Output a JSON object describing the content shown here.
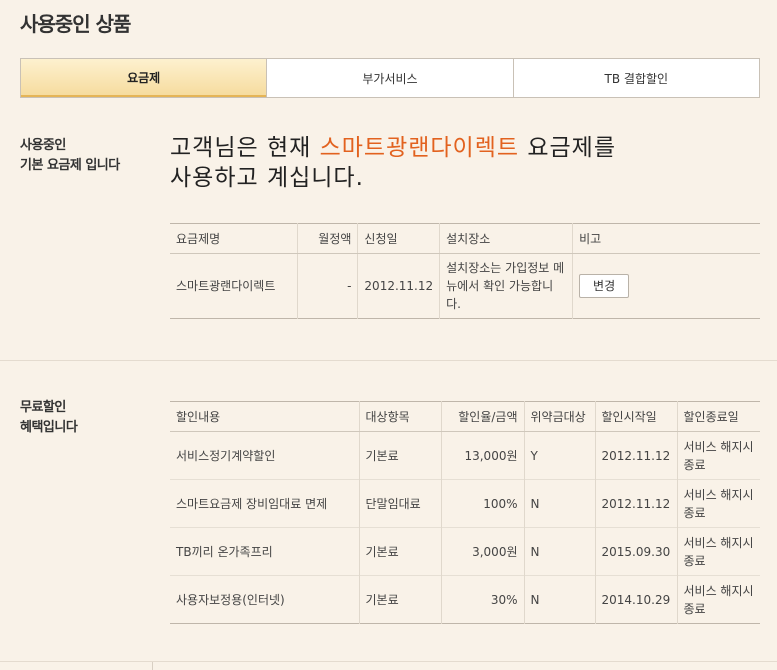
{
  "page": {
    "title": "사용중인 상품"
  },
  "tabs": [
    {
      "label": "요금제",
      "active": true
    },
    {
      "label": "부가서비스",
      "active": false
    },
    {
      "label": "TB 결합할인",
      "active": false
    }
  ],
  "basic_plan": {
    "section_label": "사용중인\n기본 요금제 입니다",
    "headline_prefix": "고객님은 현재 ",
    "headline_plan": "스마트광랜다이렉트",
    "headline_suffix_1": " 요금제를",
    "headline_line2": "사용하고 계십니다.",
    "highlight_color": "#e2621f",
    "columns": [
      "요금제명",
      "월정액",
      "신청일",
      "설치장소",
      "비고"
    ],
    "rows": [
      {
        "name": "스마트광랜다이렉트",
        "monthly_fee": "-",
        "apply_date": "2012.11.12",
        "location": "설치장소는 가입정보 메뉴에서 확인 가능합니다.",
        "action_label": "변경"
      }
    ]
  },
  "discounts": {
    "section_label": "무료할인\n혜택입니다",
    "columns": [
      "할인내용",
      "대상항목",
      "할인율/금액",
      "위약금대상",
      "할인시작일",
      "할인종료일"
    ],
    "rows": [
      {
        "content": "서비스정기계약할인",
        "target": "기본료",
        "amount": "13,000원",
        "penalty": "Y",
        "start": "2012.11.12",
        "end": "서비스 해지시 종료"
      },
      {
        "content": "스마트요금제 장비임대료 면제",
        "target": "단말임대료",
        "amount": "100%",
        "penalty": "N",
        "start": "2012.11.12",
        "end": "서비스 해지시 종료"
      },
      {
        "content": "TB끼리 온가족프리",
        "target": "기본료",
        "amount": "3,000원",
        "penalty": "N",
        "start": "2015.09.30",
        "end": "서비스 해지시 종료"
      },
      {
        "content": "사용자보정용(인터넷)",
        "target": "기본료",
        "amount": "30%",
        "penalty": "N",
        "start": "2014.10.29",
        "end": "서비스 해지시 종료"
      }
    ]
  }
}
